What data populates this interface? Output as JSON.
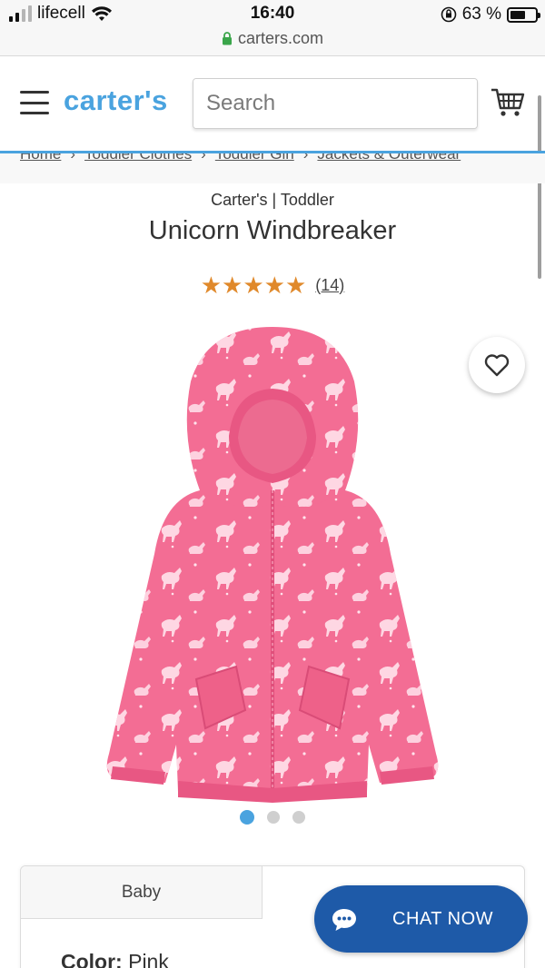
{
  "status_bar": {
    "carrier": "lifecell",
    "time": "16:40",
    "battery_percent": "63 %",
    "battery_level": 0.63
  },
  "browser": {
    "url": "carters.com"
  },
  "header": {
    "logo": "carter's",
    "search_placeholder": "Search"
  },
  "breadcrumb": [
    "Home",
    "Toddler Clothes",
    "Toddler Girl",
    "Jackets & Outerwear"
  ],
  "product": {
    "brand_line": "Carter's | Toddler",
    "title": "Unicorn Windbreaker",
    "stars": "★★★★★",
    "rating": 5,
    "review_count": "(14)",
    "carousel": {
      "total": 3,
      "active": 1
    }
  },
  "options": {
    "tabs": [
      "Baby",
      ""
    ],
    "color_label": "Color:",
    "color_value": "Pink"
  },
  "chat": {
    "label": "CHAT NOW"
  },
  "colors": {
    "brand_blue": "#4aa3df",
    "chat_blue": "#1e5aa8",
    "star_orange": "#e0892b",
    "jacket_pink": "#f36d94"
  }
}
